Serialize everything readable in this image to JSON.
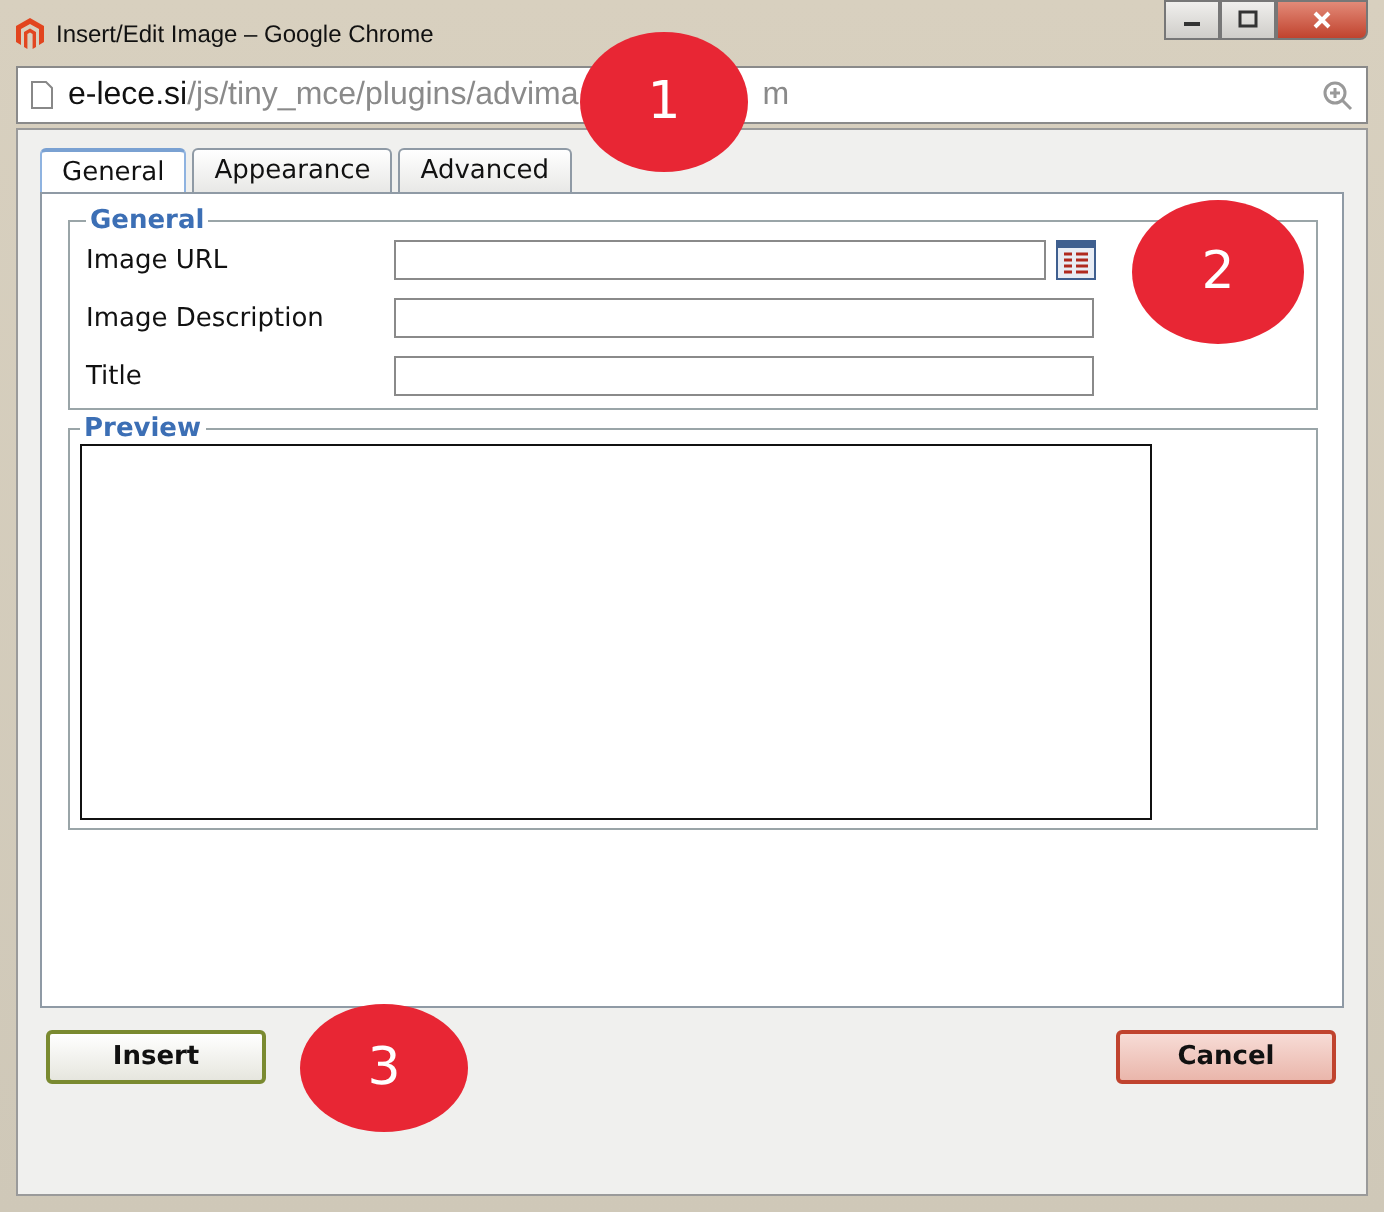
{
  "window": {
    "title": "Insert/Edit Image – Google Chrome"
  },
  "address_bar": {
    "domain": "e-lece.si",
    "path": "/js/tiny_mce/plugins/advima",
    "path_end": "m"
  },
  "tabs": [
    {
      "label": "General",
      "selected": true
    },
    {
      "label": "Appearance",
      "selected": false
    },
    {
      "label": "Advanced",
      "selected": false
    }
  ],
  "general": {
    "legend": "General",
    "fields": [
      {
        "label": "Image URL",
        "browse": true
      },
      {
        "label": "Image Description",
        "browse": false
      },
      {
        "label": "Title",
        "browse": false
      }
    ]
  },
  "preview": {
    "legend": "Preview"
  },
  "buttons": [
    {
      "label": "Insert",
      "kind": "insert"
    },
    {
      "label": "Cancel",
      "kind": "cancel"
    }
  ],
  "callouts": [
    {
      "label": "1",
      "kind": "url"
    },
    {
      "label": "2",
      "kind": "form"
    },
    {
      "label": "3",
      "kind": "buttons"
    }
  ]
}
